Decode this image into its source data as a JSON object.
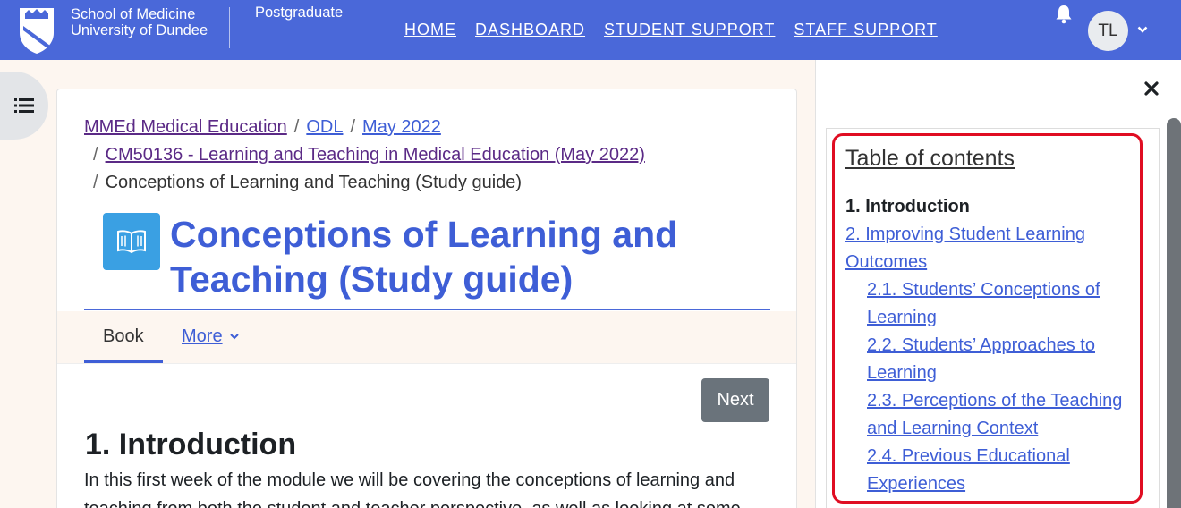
{
  "header": {
    "school_line1": "School of Medicine",
    "school_line2": "University of Dundee",
    "site": "Postgraduate",
    "nav": [
      "HOME",
      "DASHBOARD",
      "STUDENT SUPPORT",
      "STAFF SUPPORT"
    ],
    "user_initials": "TL"
  },
  "breadcrumb": {
    "items": [
      "MMEd Medical Education",
      "ODL",
      "May 2022",
      "CM50136 - Learning and Teaching in Medical Education (May 2022)"
    ],
    "current": "Conceptions of Learning and Teaching (Study guide)",
    "separator": "/"
  },
  "page": {
    "title_line1": "Conceptions of Learning and",
    "title_line2": "Teaching (Study guide)",
    "tabs": {
      "book": "Book",
      "more": "More"
    },
    "next_button": "Next",
    "section_heading": "1. Introduction",
    "section_body": "In this first week of the module we will be covering the conceptions of learning and teaching from both the student and teacher perspective, as well as looking at some"
  },
  "toc": {
    "title": "Table of contents",
    "items": [
      {
        "label": "1. Introduction",
        "current": true,
        "level": 1
      },
      {
        "label": "2. Improving Student Learning Outcomes",
        "current": false,
        "level": 1
      },
      {
        "label": "2.1. Students’ Conceptions of Learning",
        "current": false,
        "level": 2
      },
      {
        "label": "2.2. Students’ Approaches to Learning",
        "current": false,
        "level": 2
      },
      {
        "label": "2.3. Perceptions of the Teaching and Learning Context",
        "current": false,
        "level": 2
      },
      {
        "label": "2.4. Previous Educational Experiences",
        "current": false,
        "level": 2
      }
    ]
  },
  "colors": {
    "navbar": "#4a68d9",
    "link": "#3e5ed6",
    "visited_link": "#5b2a86",
    "highlight": "#e00d22",
    "book_icon_bg": "#3aa0e3"
  },
  "icons": [
    "university-shield-icon",
    "bell-icon",
    "chevron-down-icon",
    "list-icon",
    "book-icon",
    "close-icon"
  ]
}
